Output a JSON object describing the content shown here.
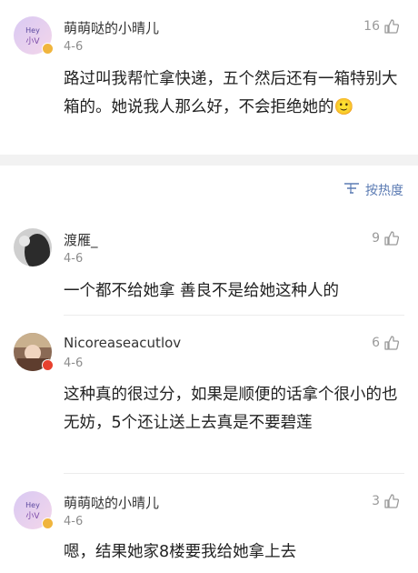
{
  "comments": [
    {
      "username": "萌萌哒的小晴儿",
      "date": "4-6",
      "likes": "16",
      "text": "路过叫我帮忙拿快递，五个然后还有一箱特别大箱的。她说我人那么好，不会拒绝她的🙂"
    }
  ],
  "sort": {
    "label": "按热度"
  },
  "replies": [
    {
      "username": "渡雁_",
      "date": "4-6",
      "likes": "9",
      "text": "一个都不给她拿 善良不是给她这种人的"
    },
    {
      "username": "Nicoreaseacutlov",
      "date": "4-6",
      "likes": "6",
      "text": "这种真的很过分，如果是顺便的话拿个很小的也无妨，5个还让送上去真是不要碧莲"
    },
    {
      "username": "萌萌哒的小晴儿",
      "date": "4-6",
      "likes": "3",
      "text": "嗯，结果她家8楼要我给她拿上去"
    }
  ],
  "colors": {
    "link": "#5b7bb3",
    "muted": "#9a9a9a",
    "gap": "#f2f2f2"
  }
}
